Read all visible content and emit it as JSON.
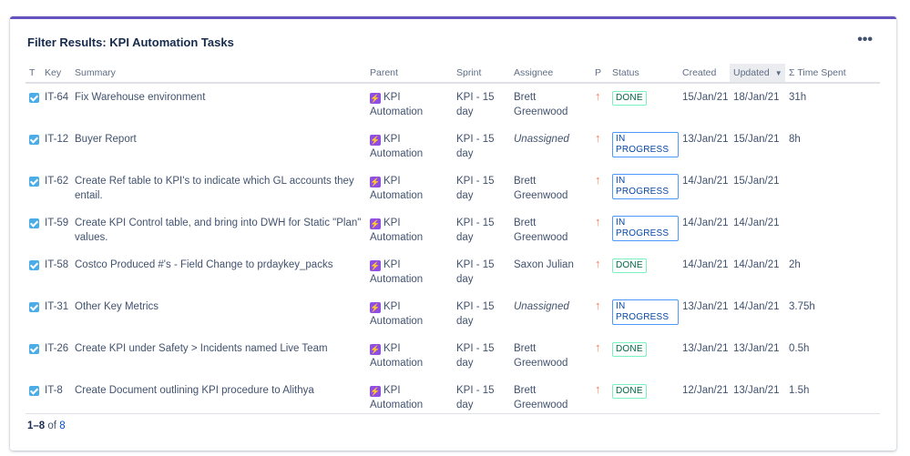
{
  "gadget": {
    "title": "Filter Results: KPI Automation Tasks",
    "more_label": "•••"
  },
  "columns": {
    "type": "T",
    "key": "Key",
    "summary": "Summary",
    "parent": "Parent",
    "sprint": "Sprint",
    "assignee": "Assignee",
    "priority": "P",
    "status": "Status",
    "created": "Created",
    "updated": "Updated",
    "time_spent": "Σ Time Spent"
  },
  "rows": [
    {
      "key": "IT-64",
      "summary": "Fix Warehouse environment",
      "parent": "KPI Automation",
      "sprint": "KPI - 15 day",
      "assignee": "Brett Greenwood",
      "status": "DONE",
      "created": "15/Jan/21",
      "updated": "18/Jan/21",
      "time_spent": "31h"
    },
    {
      "key": "IT-12",
      "summary": "Buyer Report",
      "parent": "KPI Automation",
      "sprint": "KPI - 15 day",
      "assignee": "Unassigned",
      "status": "IN PROGRESS",
      "created": "13/Jan/21",
      "updated": "15/Jan/21",
      "time_spent": "8h"
    },
    {
      "key": "IT-62",
      "summary": "Create Ref table to KPI's to indicate which GL accounts they entail.",
      "parent": "KPI Automation",
      "sprint": "KPI - 15 day",
      "assignee": "Brett Greenwood",
      "status": "IN PROGRESS",
      "created": "14/Jan/21",
      "updated": "15/Jan/21",
      "time_spent": ""
    },
    {
      "key": "IT-59",
      "summary": "Create KPI Control table, and bring into DWH for Static \"Plan\" values.",
      "parent": "KPI Automation",
      "sprint": "KPI - 15 day",
      "assignee": "Brett Greenwood",
      "status": "IN PROGRESS",
      "created": "14/Jan/21",
      "updated": "14/Jan/21",
      "time_spent": ""
    },
    {
      "key": "IT-58",
      "summary": "Costco Produced #'s - Field Change to prdaykey_packs",
      "parent": "KPI Automation",
      "sprint": "KPI - 15 day",
      "assignee": "Saxon Julian",
      "status": "DONE",
      "created": "14/Jan/21",
      "updated": "14/Jan/21",
      "time_spent": "2h"
    },
    {
      "key": "IT-31",
      "summary": "Other Key Metrics",
      "parent": "KPI Automation",
      "sprint": "KPI - 15 day",
      "assignee": "Unassigned",
      "status": "IN PROGRESS",
      "created": "13/Jan/21",
      "updated": "14/Jan/21",
      "time_spent": "3.75h"
    },
    {
      "key": "IT-26",
      "summary": "Create KPI under Safety > Incidents named Live Team",
      "parent": "KPI Automation",
      "sprint": "KPI - 15 day",
      "assignee": "Brett Greenwood",
      "status": "DONE",
      "created": "13/Jan/21",
      "updated": "13/Jan/21",
      "time_spent": "0.5h"
    },
    {
      "key": "IT-8",
      "summary": "Create Document outlining KPI procedure to Alithya",
      "parent": "KPI Automation",
      "sprint": "KPI - 15 day",
      "assignee": "Brett Greenwood",
      "status": "DONE",
      "created": "12/Jan/21",
      "updated": "13/Jan/21",
      "time_spent": "1.5h"
    }
  ],
  "footer": {
    "range": "1–8",
    "of": "of",
    "total": "8"
  },
  "icons": {
    "type": "task-checkbox-icon",
    "parent": "epic-lightning-icon",
    "priority": "priority-high-arrow-icon",
    "sort": "chevron-down-icon",
    "more": "more-horizontal-icon"
  },
  "colors": {
    "accent_border": "#6554c0",
    "task_icon": "#4bade8",
    "epic_icon": "#904ee2",
    "priority": "#ff7452",
    "done_text": "#006644",
    "in_progress_text": "#0747a6",
    "link": "#0052cc"
  }
}
